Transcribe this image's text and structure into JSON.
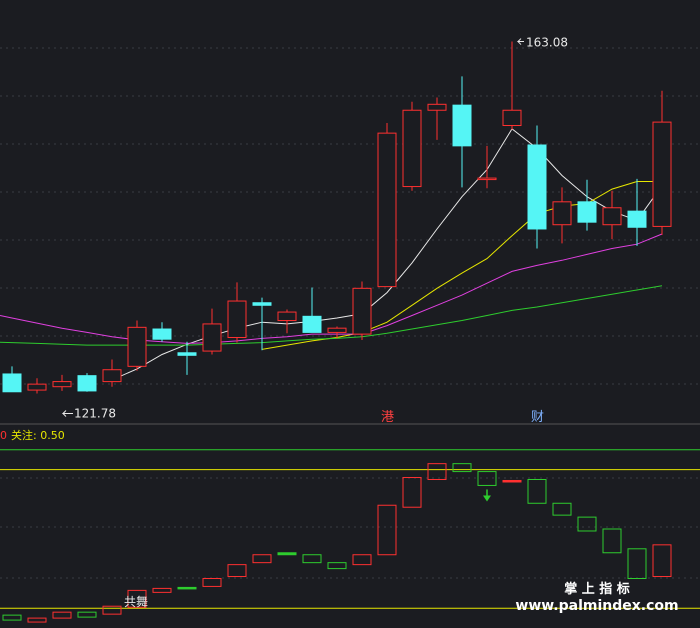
{
  "chart_data": [
    {
      "type": "candlestick",
      "title": "",
      "grid": true,
      "legend": "none",
      "ylim": [
        118,
        168
      ],
      "annotations": {
        "high_label": "163.08",
        "low_label": "121.78",
        "event_labels": [
          {
            "text": "港",
            "index": 15,
            "color": "#ff4040"
          },
          {
            "text": "财",
            "index": 21,
            "color": "#7fb2ff"
          }
        ]
      },
      "candles": [
        {
          "o": 123.9,
          "h": 124.8,
          "l": 121.8,
          "c": 121.8
        },
        {
          "o": 122.0,
          "h": 123.4,
          "l": 121.6,
          "c": 122.7
        },
        {
          "o": 122.4,
          "h": 123.8,
          "l": 121.9,
          "c": 123.0
        },
        {
          "o": 123.7,
          "h": 124.0,
          "l": 121.8,
          "c": 121.9
        },
        {
          "o": 123.0,
          "h": 125.6,
          "l": 122.4,
          "c": 124.4
        },
        {
          "o": 124.8,
          "h": 130.2,
          "l": 124.3,
          "c": 129.4
        },
        {
          "o": 129.2,
          "h": 130.0,
          "l": 127.7,
          "c": 128.0
        },
        {
          "o": 126.4,
          "h": 127.7,
          "l": 123.8,
          "c": 126.1
        },
        {
          "o": 126.6,
          "h": 131.6,
          "l": 126.2,
          "c": 129.8
        },
        {
          "o": 128.2,
          "h": 134.7,
          "l": 127.6,
          "c": 132.5
        },
        {
          "o": 132.3,
          "h": 132.9,
          "l": 126.7,
          "c": 132.0
        },
        {
          "o": 130.2,
          "h": 131.5,
          "l": 128.7,
          "c": 131.2
        },
        {
          "o": 130.7,
          "h": 134.1,
          "l": 128.8,
          "c": 128.8
        },
        {
          "o": 128.8,
          "h": 129.5,
          "l": 128.1,
          "c": 129.3
        },
        {
          "o": 128.6,
          "h": 134.8,
          "l": 127.9,
          "c": 134.0
        },
        {
          "o": 134.2,
          "h": 153.5,
          "l": 134.2,
          "c": 152.3
        },
        {
          "o": 146.0,
          "h": 156.0,
          "l": 145.5,
          "c": 155.0
        },
        {
          "o": 155.0,
          "h": 156.5,
          "l": 151.5,
          "c": 155.7
        },
        {
          "o": 155.6,
          "h": 159.0,
          "l": 145.9,
          "c": 150.8
        },
        {
          "o": 147.0,
          "h": 150.8,
          "l": 145.8,
          "c": 147.0
        },
        {
          "o": 153.2,
          "h": 163.1,
          "l": 152.7,
          "c": 155.0
        },
        {
          "o": 150.9,
          "h": 153.2,
          "l": 138.7,
          "c": 141.0
        },
        {
          "o": 141.5,
          "h": 145.9,
          "l": 139.3,
          "c": 144.2
        },
        {
          "o": 144.2,
          "h": 146.8,
          "l": 140.8,
          "c": 141.8
        },
        {
          "o": 141.5,
          "h": 145.5,
          "l": 139.8,
          "c": 143.5
        },
        {
          "o": 143.1,
          "h": 146.9,
          "l": 139.0,
          "c": 141.2
        },
        {
          "o": 141.3,
          "h": 157.3,
          "l": 140.3,
          "c": 153.6
        }
      ],
      "ma": [
        {
          "name": "",
          "color": "#e8e8e8",
          "values": [
            null,
            null,
            null,
            null,
            123.2,
            124.5,
            126.2,
            127.4,
            128.4,
            129.3,
            130.0,
            129.8,
            130.1,
            130.5,
            131.0,
            133.5,
            137.0,
            141.0,
            144.8,
            148.0,
            152.8,
            150.5,
            147.3,
            144.8,
            143.1,
            142.0,
            146.1
          ]
        },
        {
          "name": "",
          "color": "#e6e600",
          "values": [
            null,
            null,
            null,
            null,
            null,
            null,
            null,
            null,
            null,
            null,
            126.8,
            127.3,
            127.8,
            128.2,
            128.8,
            130.0,
            132.0,
            134.0,
            135.8,
            137.5,
            140.2,
            142.8,
            143.7,
            144.0,
            145.7,
            146.6,
            146.6
          ]
        },
        {
          "name": "",
          "color": "#e040e0",
          "values": [
            130.5,
            129.9,
            129.3,
            128.8,
            128.3,
            127.9,
            127.7,
            127.5,
            127.6,
            127.8,
            128.1,
            128.3,
            128.6,
            128.6,
            128.6,
            129.6,
            130.8,
            132.0,
            133.2,
            134.6,
            136.0,
            136.7,
            137.3,
            138.0,
            138.7,
            139.2,
            140.4
          ]
        },
        {
          "name": "",
          "color": "#2ecc2e",
          "values": [
            127.6,
            127.5,
            127.4,
            127.3,
            127.3,
            127.3,
            127.3,
            127.3,
            127.4,
            127.5,
            127.6,
            127.8,
            128.0,
            128.1,
            128.3,
            128.7,
            129.2,
            129.7,
            130.2,
            130.8,
            131.4,
            131.8,
            132.3,
            132.8,
            133.3,
            133.8,
            134.3
          ]
        }
      ]
    },
    {
      "type": "indicator",
      "title_prefix": "0",
      "title": "关注: 0.50",
      "ylim": [
        0,
        1
      ],
      "levels": [
        {
          "value": 0.9,
          "color": "#2ecc2e"
        },
        {
          "value": 0.8,
          "color": "#e6e600"
        },
        {
          "value": 0.1,
          "color": "#e6e600"
        }
      ],
      "boxes": [
        {
          "top": 0.065,
          "bottom": 0.04,
          "color": "#2ecc2e"
        },
        {
          "top": 0.05,
          "bottom": 0.03,
          "color": "#ff3030"
        },
        {
          "top": 0.08,
          "bottom": 0.05,
          "color": "#ff3030"
        },
        {
          "top": 0.08,
          "bottom": 0.055,
          "color": "#2ecc2e"
        },
        {
          "top": 0.11,
          "bottom": 0.07,
          "color": "#ff3030"
        },
        {
          "top": 0.19,
          "bottom": 0.105,
          "color": "#ff3030"
        },
        {
          "top": 0.2,
          "bottom": 0.18,
          "color": "#ff3030"
        },
        {
          "top": 0.205,
          "bottom": 0.2,
          "color": "#2ecc2e"
        },
        {
          "top": 0.25,
          "bottom": 0.21,
          "color": "#ff3030"
        },
        {
          "top": 0.32,
          "bottom": 0.26,
          "color": "#ff3030"
        },
        {
          "top": 0.37,
          "bottom": 0.33,
          "color": "#ff3030"
        },
        {
          "top": 0.38,
          "bottom": 0.37,
          "color": "#2ecc2e"
        },
        {
          "top": 0.37,
          "bottom": 0.33,
          "color": "#2ecc2e"
        },
        {
          "top": 0.33,
          "bottom": 0.3,
          "color": "#2ecc2e"
        },
        {
          "top": 0.37,
          "bottom": 0.32,
          "color": "#ff3030"
        },
        {
          "top": 0.62,
          "bottom": 0.37,
          "color": "#ff3030"
        },
        {
          "top": 0.76,
          "bottom": 0.61,
          "color": "#ff3030"
        },
        {
          "top": 0.83,
          "bottom": 0.75,
          "color": "#ff3030"
        },
        {
          "top": 0.83,
          "bottom": 0.79,
          "color": "#2ecc2e"
        },
        {
          "top": 0.79,
          "bottom": 0.72,
          "color": "#2ecc2e"
        },
        {
          "top": 0.745,
          "bottom": 0.74,
          "color": "#ff3030"
        },
        {
          "top": 0.75,
          "bottom": 0.63,
          "color": "#2ecc2e"
        },
        {
          "top": 0.63,
          "bottom": 0.57,
          "color": "#2ecc2e"
        },
        {
          "top": 0.56,
          "bottom": 0.49,
          "color": "#2ecc2e"
        },
        {
          "top": 0.5,
          "bottom": 0.38,
          "color": "#2ecc2e"
        },
        {
          "top": 0.4,
          "bottom": 0.25,
          "color": "#2ecc2e"
        },
        {
          "top": 0.42,
          "bottom": 0.26,
          "color": "#ff3030"
        }
      ],
      "arrow_index": 19,
      "signal_label": {
        "text": "共舞",
        "index": 4
      }
    }
  ],
  "watermark": {
    "line1": "掌 上 指 标",
    "line2": "www.palmindex.com"
  },
  "colors": {
    "background": "#1b1c21",
    "up": "#ff3030",
    "down": "#55f5f5",
    "grid": "#3a3b44"
  }
}
